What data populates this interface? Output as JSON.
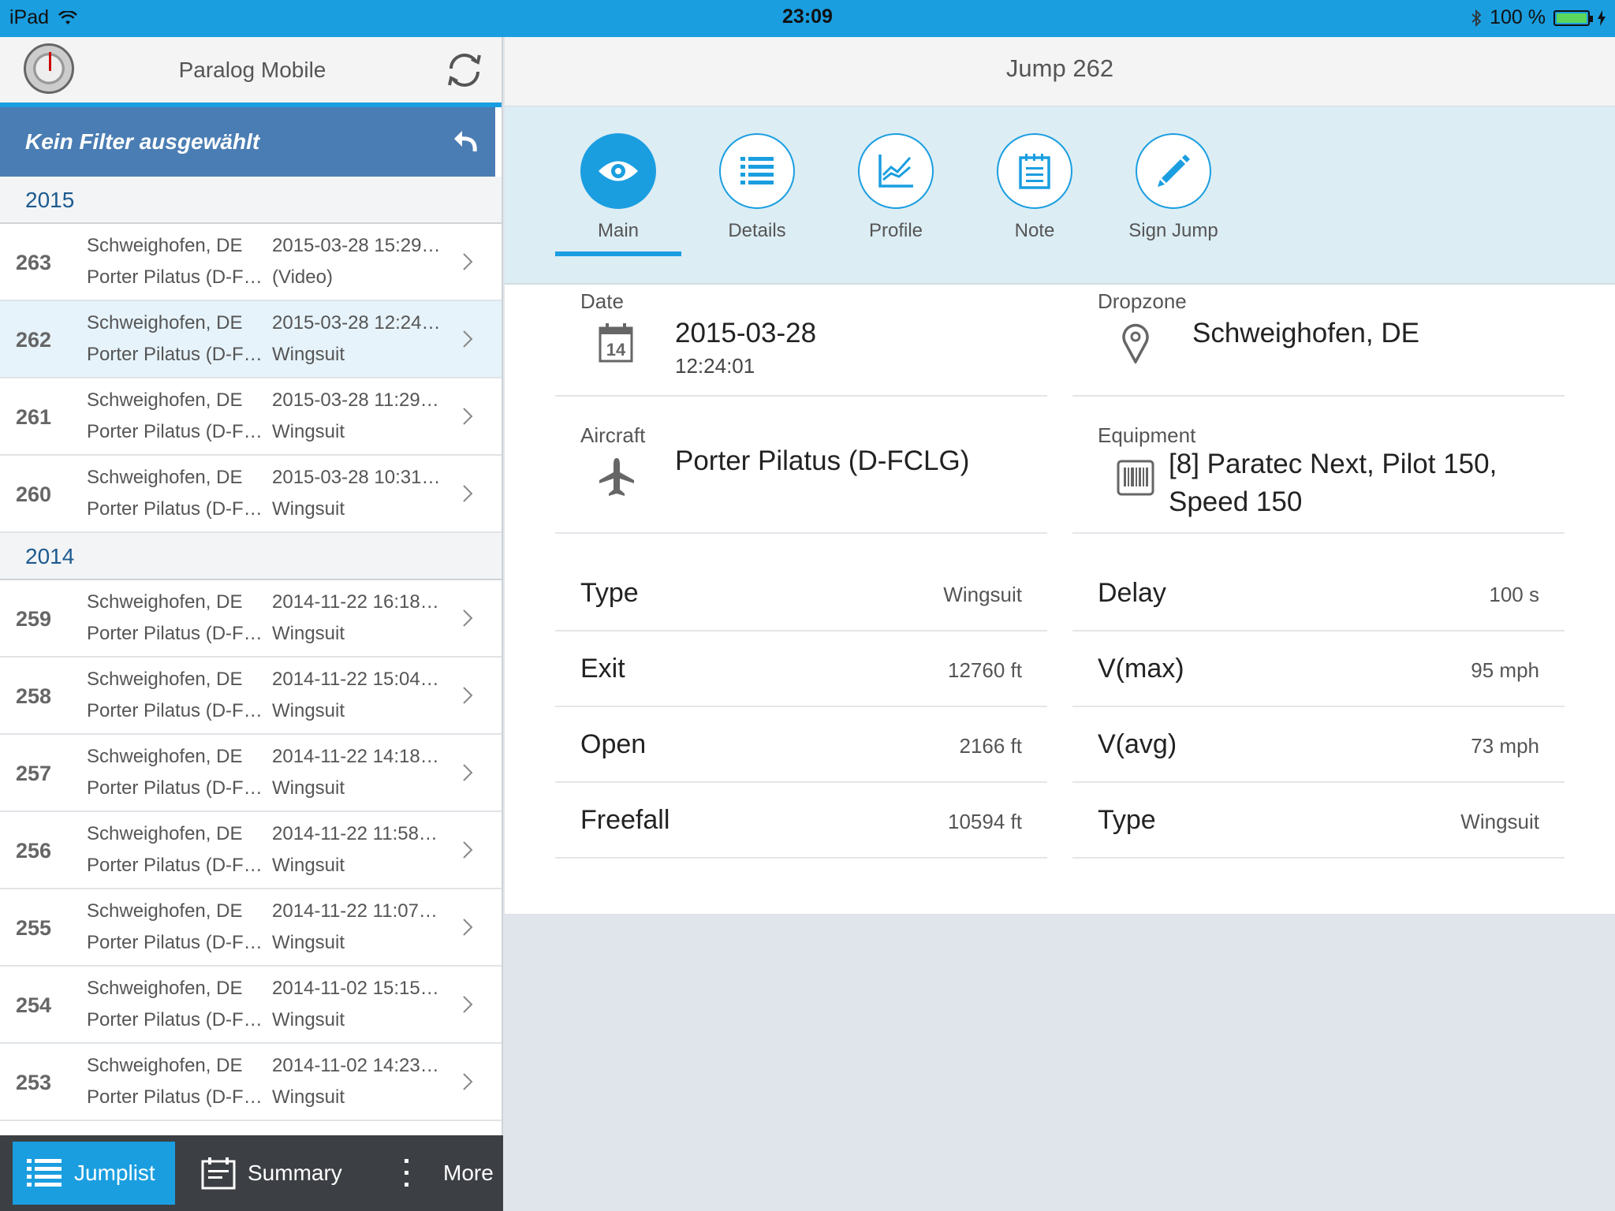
{
  "status": {
    "device": "iPad",
    "time": "23:09",
    "battery": "100 %"
  },
  "app": {
    "title": "Paralog Mobile"
  },
  "filter": {
    "label": "Kein Filter ausgewählt"
  },
  "groups": [
    {
      "year": "2015",
      "jumps": [
        {
          "num": "263",
          "place": "Schweighofen, DE",
          "date": "2015-03-28 15:29…",
          "aircraft": "Porter Pilatus (D-F…",
          "type": "(Video)"
        },
        {
          "num": "262",
          "place": "Schweighofen, DE",
          "date": "2015-03-28 12:24…",
          "aircraft": "Porter Pilatus (D-F…",
          "type": "Wingsuit"
        },
        {
          "num": "261",
          "place": "Schweighofen, DE",
          "date": "2015-03-28 11:29…",
          "aircraft": "Porter Pilatus (D-F…",
          "type": "Wingsuit"
        },
        {
          "num": "260",
          "place": "Schweighofen, DE",
          "date": "2015-03-28 10:31…",
          "aircraft": "Porter Pilatus (D-F…",
          "type": "Wingsuit"
        }
      ]
    },
    {
      "year": "2014",
      "jumps": [
        {
          "num": "259",
          "place": "Schweighofen, DE",
          "date": "2014-11-22 16:18…",
          "aircraft": "Porter Pilatus (D-F…",
          "type": "Wingsuit"
        },
        {
          "num": "258",
          "place": "Schweighofen, DE",
          "date": "2014-11-22 15:04…",
          "aircraft": "Porter Pilatus (D-F…",
          "type": "Wingsuit"
        },
        {
          "num": "257",
          "place": "Schweighofen, DE",
          "date": "2014-11-22 14:18…",
          "aircraft": "Porter Pilatus (D-F…",
          "type": "Wingsuit"
        },
        {
          "num": "256",
          "place": "Schweighofen, DE",
          "date": "2014-11-22 11:58…",
          "aircraft": "Porter Pilatus (D-F…",
          "type": "Wingsuit"
        },
        {
          "num": "255",
          "place": "Schweighofen, DE",
          "date": "2014-11-22 11:07…",
          "aircraft": "Porter Pilatus (D-F…",
          "type": "Wingsuit"
        },
        {
          "num": "254",
          "place": "Schweighofen, DE",
          "date": "2014-11-02 15:15…",
          "aircraft": "Porter Pilatus (D-F…",
          "type": "Wingsuit"
        },
        {
          "num": "253",
          "place": "Schweighofen, DE",
          "date": "2014-11-02 14:23…",
          "aircraft": "Porter Pilatus (D-F…",
          "type": "Wingsuit"
        }
      ]
    }
  ],
  "tabbar": {
    "jumplist": "Jumplist",
    "summary": "Summary",
    "more": "More"
  },
  "detail": {
    "title": "Jump 262",
    "tabs": [
      "Main",
      "Details",
      "Profile",
      "Note",
      "Sign Jump"
    ],
    "date_label": "Date",
    "date": "2015-03-28",
    "time": "12:24:01",
    "dropzone_label": "Dropzone",
    "dropzone": "Schweighofen, DE",
    "aircraft_label": "Aircraft",
    "aircraft": "Porter Pilatus (D-FCLG)",
    "equipment_label": "Equipment",
    "equipment_line1": "[8] Paratec Next, Pilot 150,",
    "equipment_line2": "Speed 150",
    "calendar_day": "14",
    "left_rows": [
      {
        "k": "Type",
        "v": "Wingsuit"
      },
      {
        "k": "Exit",
        "v": "12760 ft"
      },
      {
        "k": "Open",
        "v": "2166 ft"
      },
      {
        "k": "Freefall",
        "v": "10594 ft"
      }
    ],
    "right_rows": [
      {
        "k": "Delay",
        "v": "100 s"
      },
      {
        "k": "V(max)",
        "v": "95 mph"
      },
      {
        "k": "V(avg)",
        "v": "73 mph"
      },
      {
        "k": "Type",
        "v": "Wingsuit"
      }
    ]
  }
}
